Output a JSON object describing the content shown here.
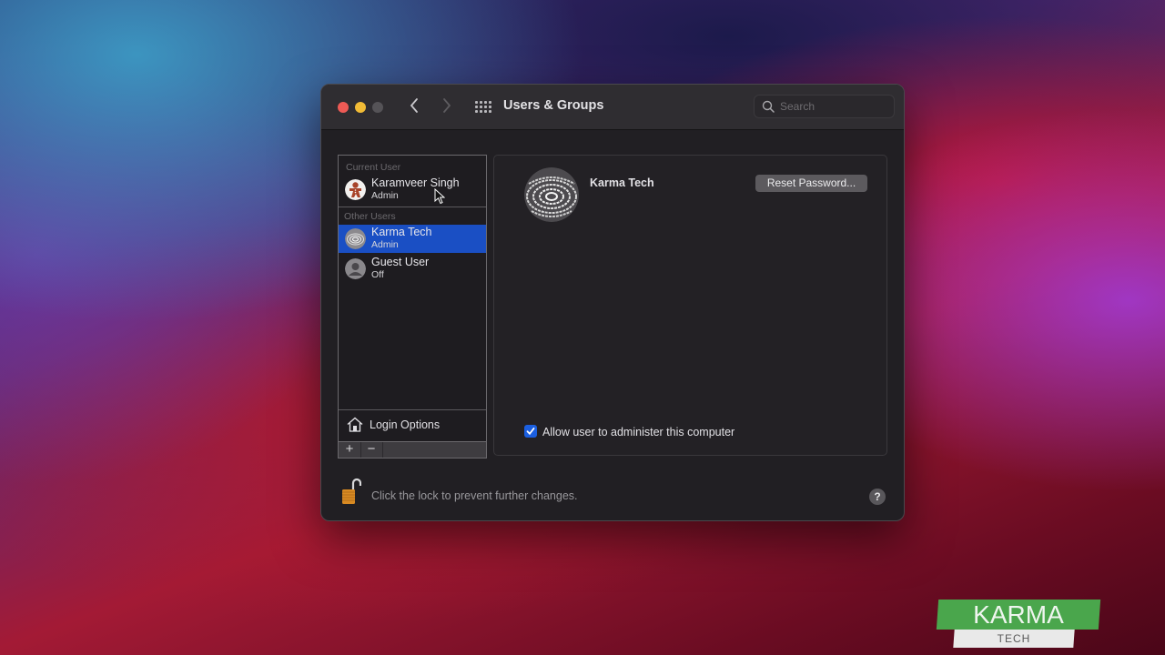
{
  "window": {
    "title": "Users & Groups",
    "search": {
      "placeholder": "Search",
      "value": ""
    },
    "nav": {
      "back_icon": "chevron-left-icon",
      "forward_icon": "chevron-right-icon",
      "show_all_icon": "grid-icon"
    }
  },
  "sidebar": {
    "current_user_label": "Current User",
    "other_users_label": "Other Users",
    "current_user": {
      "name": "Karamveer Singh",
      "role": "Admin"
    },
    "other_users": [
      {
        "name": "Karma Tech",
        "role": "Admin",
        "selected": true
      },
      {
        "name": "Guest User",
        "role": "Off",
        "selected": false
      }
    ],
    "login_options_label": "Login Options",
    "add_label": "+",
    "remove_label": "−"
  },
  "detail": {
    "user_name": "Karma Tech",
    "reset_password_label": "Reset Password...",
    "allow_admin_label": "Allow user to administer this computer",
    "allow_admin_checked": true
  },
  "footer": {
    "lock_text": "Click the lock to prevent further changes.",
    "help_label": "?"
  },
  "watermark": {
    "top": "KARMA",
    "bottom": "TECH"
  },
  "colors": {
    "selection": "#1a4fc4",
    "checkbox": "#1b5fe0",
    "close": "#ed5a55",
    "minimize": "#f1bb36",
    "logo_green": "#4aa64c"
  }
}
